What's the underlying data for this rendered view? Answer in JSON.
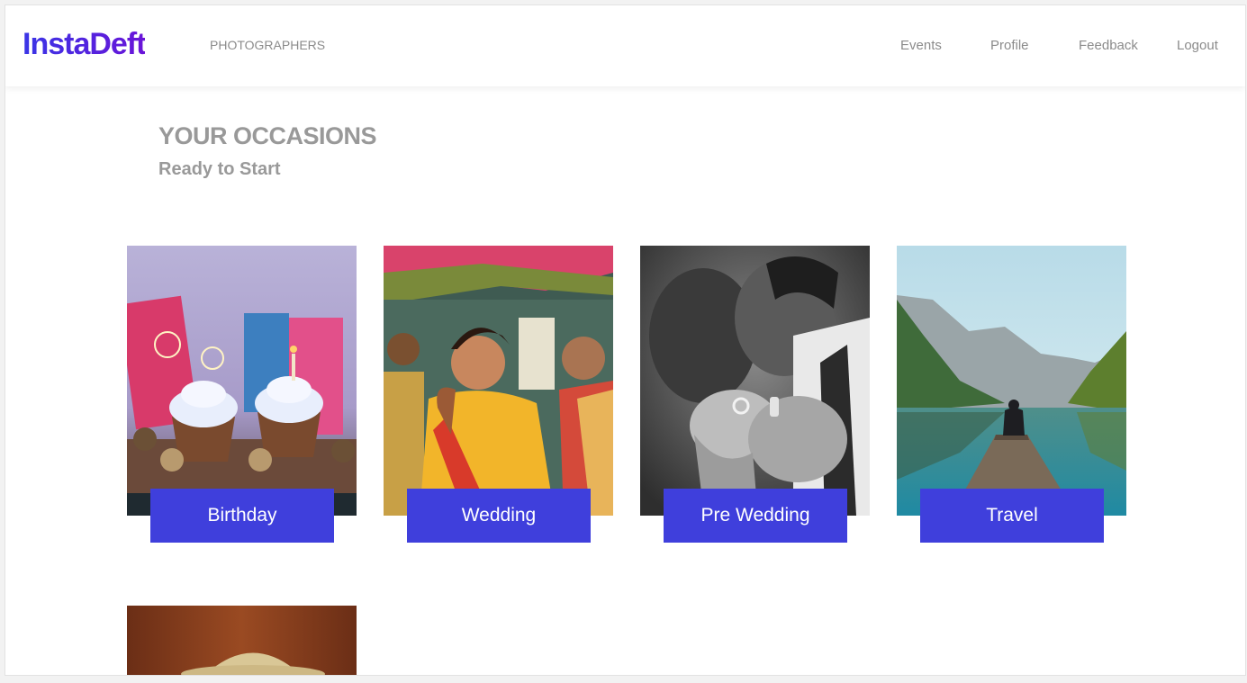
{
  "brand": {
    "name": "InstaDeft"
  },
  "nav": {
    "left": [
      {
        "label": "PHOTOGRAPHERS"
      }
    ],
    "right": [
      {
        "label": "Events"
      },
      {
        "label": "Profile"
      },
      {
        "label": "Feedback"
      },
      {
        "label": "Logout"
      }
    ]
  },
  "page": {
    "title": "YOUR OCCASIONS",
    "subtitle": "Ready to Start"
  },
  "occasions": [
    {
      "label": "Birthday",
      "image": "cupcakes-with-sparklers"
    },
    {
      "label": "Wedding",
      "image": "bride-in-yellow-saree"
    },
    {
      "label": "Pre Wedding",
      "image": "couple-holding-rings-bw"
    },
    {
      "label": "Travel",
      "image": "person-on-lake-pier-mountains"
    },
    {
      "label": "",
      "image": "straw-hat-on-wood"
    }
  ],
  "colors": {
    "accent": "#3f3fdc",
    "brand": "#4a28e0",
    "muted_text": "#999999"
  }
}
